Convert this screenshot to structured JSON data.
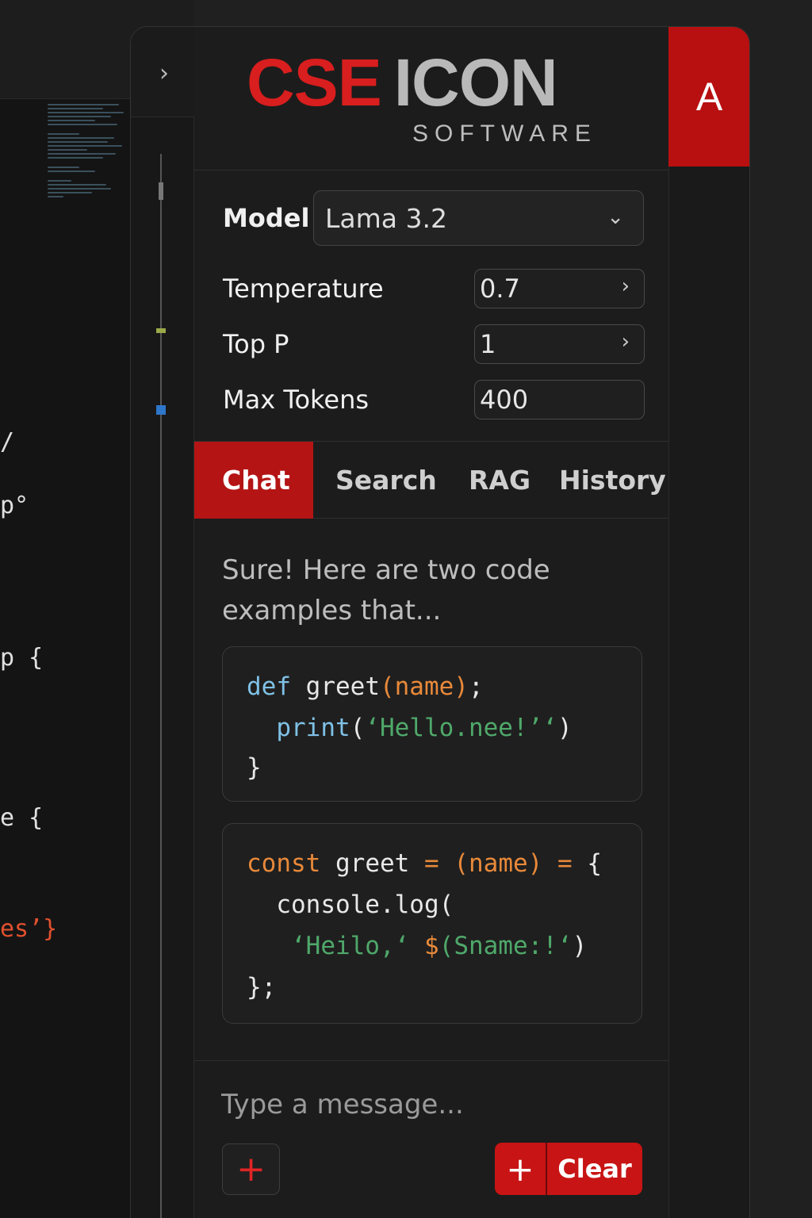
{
  "background_editor": {
    "code_fragments": [
      "/",
      "p°",
      "p {",
      "e {",
      "es’}"
    ]
  },
  "header": {
    "logo_primary": "CSE",
    "logo_secondary": "ICON",
    "logo_tagline": "SOFTWARE",
    "avatar_initial": "A"
  },
  "gutter": {
    "collapse_icon": "chevron-right-icon",
    "collapse_glyph": "›"
  },
  "settings": {
    "model_label": "Model",
    "model_value": "Lama 3.2",
    "temperature_label": "Temperature",
    "temperature_value": "0.7",
    "top_p_label": "Top P",
    "top_p_value": "1",
    "max_tokens_label": "Max Tokens",
    "max_tokens_value": "400"
  },
  "tabs": [
    {
      "label": "Chat",
      "active": true
    },
    {
      "label": "Search",
      "active": false
    },
    {
      "label": "RAG",
      "active": false
    },
    {
      "label": "History",
      "active": false
    }
  ],
  "chat": {
    "assistant_message": "Sure! Here are two code examples that...",
    "code_blocks": [
      {
        "lines": [
          [
            {
              "t": "def",
              "c": "blue"
            },
            {
              "t": " greet",
              "c": "plain"
            },
            {
              "t": "(name)",
              "c": "orange"
            },
            {
              "t": ";",
              "c": "plain"
            }
          ],
          [
            {
              "t": "  print",
              "c": "blue"
            },
            {
              "t": "(",
              "c": "plain"
            },
            {
              "t": "‘Hello.nee!’‘",
              "c": "green"
            },
            {
              "t": ")",
              "c": "plain"
            }
          ],
          [
            {
              "t": "}",
              "c": "plain"
            }
          ]
        ]
      },
      {
        "lines": [
          [
            {
              "t": "const",
              "c": "orange"
            },
            {
              "t": " greet ",
              "c": "plain"
            },
            {
              "t": "=",
              "c": "orange"
            },
            {
              "t": " ",
              "c": "plain"
            },
            {
              "t": "(name)",
              "c": "orange"
            },
            {
              "t": " ",
              "c": "plain"
            },
            {
              "t": "=",
              "c": "orange"
            },
            {
              "t": " {",
              "c": "plain"
            }
          ],
          [
            {
              "t": "  console.log(",
              "c": "plain"
            }
          ],
          [
            {
              "t": "   ‘Heilo,‘",
              "c": "green"
            },
            {
              "t": " ",
              "c": "plain"
            },
            {
              "t": "$",
              "c": "orange"
            },
            {
              "t": "(Sname:!‘",
              "c": "green"
            },
            {
              "t": ")",
              "c": "plain"
            }
          ],
          [
            {
              "t": "};",
              "c": "plain"
            }
          ]
        ]
      }
    ]
  },
  "composer": {
    "placeholder": "Type a message...",
    "attach_icon": "plus-icon",
    "add_icon": "plus-icon",
    "plus_glyph": "+",
    "clear_label": "Clear"
  },
  "colors": {
    "accent_red": "#b41414",
    "logo_red": "#d81e1e",
    "keyword_blue": "#7fc1e6",
    "keyword_orange": "#e8893a",
    "string_green": "#4fa86a"
  },
  "icons": {
    "model_dropdown": "chevron-down-icon",
    "field_stepper": "chevron-right-icon"
  }
}
